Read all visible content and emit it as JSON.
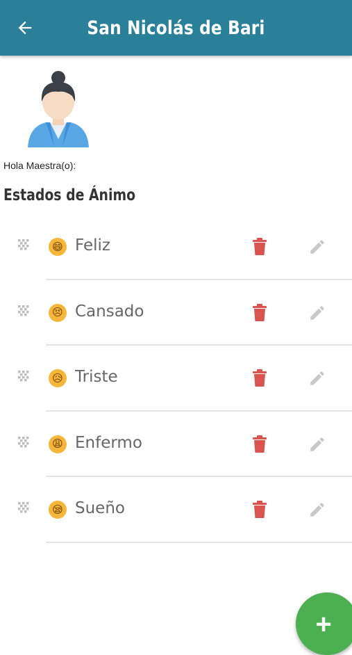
{
  "appbar": {
    "title": "San Nicolás de Bari",
    "back_icon": "arrow-left-icon",
    "color": "#2a7f99"
  },
  "profile": {
    "avatar_icon": "teacher-avatar-icon",
    "greeting": "Hola Maestra(o):"
  },
  "section": {
    "title": "Estados de Ánimo"
  },
  "moods": [
    {
      "label": "Feliz",
      "emoji": "😄",
      "icon": "grinning-face-icon"
    },
    {
      "label": "Cansado",
      "emoji": "😣",
      "icon": "tired-face-icon"
    },
    {
      "label": "Triste",
      "emoji": "😥",
      "icon": "sad-face-icon"
    },
    {
      "label": "Enfermo",
      "emoji": "😩",
      "icon": "sick-face-icon"
    },
    {
      "label": "Sueño",
      "emoji": "😪",
      "icon": "sleepy-face-icon"
    }
  ],
  "actions": {
    "delete_icon": "trash-icon",
    "edit_icon": "pencil-icon",
    "drag_icon": "drag-handle-icon",
    "delete_color": "#d9534f",
    "edit_color": "#c8c8c8"
  },
  "fab": {
    "label": "+",
    "icon": "plus-icon",
    "color": "#4caf50"
  }
}
